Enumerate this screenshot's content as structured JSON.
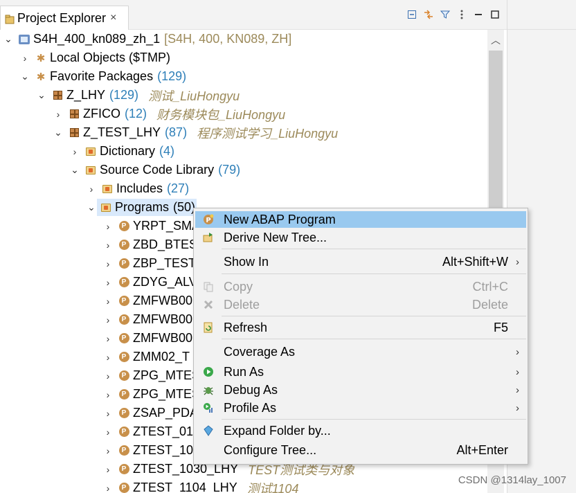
{
  "tab": {
    "title": "Project Explorer",
    "close": "×"
  },
  "toolbar": {
    "icons": [
      "collapse-all-icon",
      "link-with-editor-icon",
      "filter-icon",
      "view-menu-icon",
      "minimize-icon",
      "maximize-icon"
    ]
  },
  "tree": {
    "project": {
      "name": "S4H_400_kn089_zh_1",
      "detail": "[S4H, 400, KN089, ZH]"
    },
    "local_objects": {
      "label": "Local Objects ($TMP)"
    },
    "favorites": {
      "label": "Favorite Packages",
      "count": "(129)"
    },
    "z_lhy": {
      "label": "Z_LHY",
      "count": "(129)",
      "desc": "测试_LiuHongyu"
    },
    "zfico": {
      "label": "ZFICO",
      "count": "(12)",
      "desc": "财务模块包_LiuHongyu"
    },
    "z_test_lhy": {
      "label": "Z_TEST_LHY",
      "count": "(87)",
      "desc": "程序测试学习_LiuHongyu"
    },
    "dictionary": {
      "label": "Dictionary",
      "count": "(4)"
    },
    "source_lib": {
      "label": "Source Code Library",
      "count": "(79)"
    },
    "includes": {
      "label": "Includes",
      "count": "(27)"
    },
    "programs": {
      "label": "Programs",
      "count": "(50)"
    },
    "program_items": [
      {
        "name": "YRPT_SMA",
        "desc": ""
      },
      {
        "name": "ZBD_BTES",
        "desc": ""
      },
      {
        "name": "ZBP_TESTC",
        "desc": ""
      },
      {
        "name": "ZDYG_ALV",
        "desc": ""
      },
      {
        "name": "ZMFWB00",
        "desc": ""
      },
      {
        "name": "ZMFWB00",
        "desc": ""
      },
      {
        "name": "ZMFWB00",
        "desc": ""
      },
      {
        "name": "ZMM02_T",
        "desc": ""
      },
      {
        "name": "ZPG_MTES",
        "desc": ""
      },
      {
        "name": "ZPG_MTES",
        "desc": ""
      },
      {
        "name": "ZSAP_PDA",
        "desc": ""
      },
      {
        "name": "ZTEST_011",
        "desc": ""
      },
      {
        "name": "ZTEST_102",
        "desc": ""
      },
      {
        "name": "ZTEST_1030_LHY",
        "desc": "TEST测试类与对象"
      },
      {
        "name": "ZTEST_1104_LHY",
        "desc": "测试1104"
      }
    ]
  },
  "context_menu": {
    "new_abap_program": "New ABAP Program",
    "derive_new_tree": "Derive New Tree...",
    "show_in": {
      "label": "Show In",
      "shortcut": "Alt+Shift+W"
    },
    "copy": {
      "label": "Copy",
      "shortcut": "Ctrl+C"
    },
    "delete": {
      "label": "Delete",
      "shortcut": "Delete"
    },
    "refresh": {
      "label": "Refresh",
      "shortcut": "F5"
    },
    "coverage_as": "Coverage As",
    "run_as": "Run As",
    "debug_as": "Debug As",
    "profile_as": "Profile As",
    "expand_folder_by": "Expand Folder by...",
    "configure_tree": {
      "label": "Configure Tree...",
      "shortcut": "Alt+Enter"
    }
  },
  "watermark": "CSDN @1314lay_1007",
  "colors": {
    "selection": "#99c9ef",
    "count": "#2e7fb8",
    "description": "#9c8a5a"
  }
}
